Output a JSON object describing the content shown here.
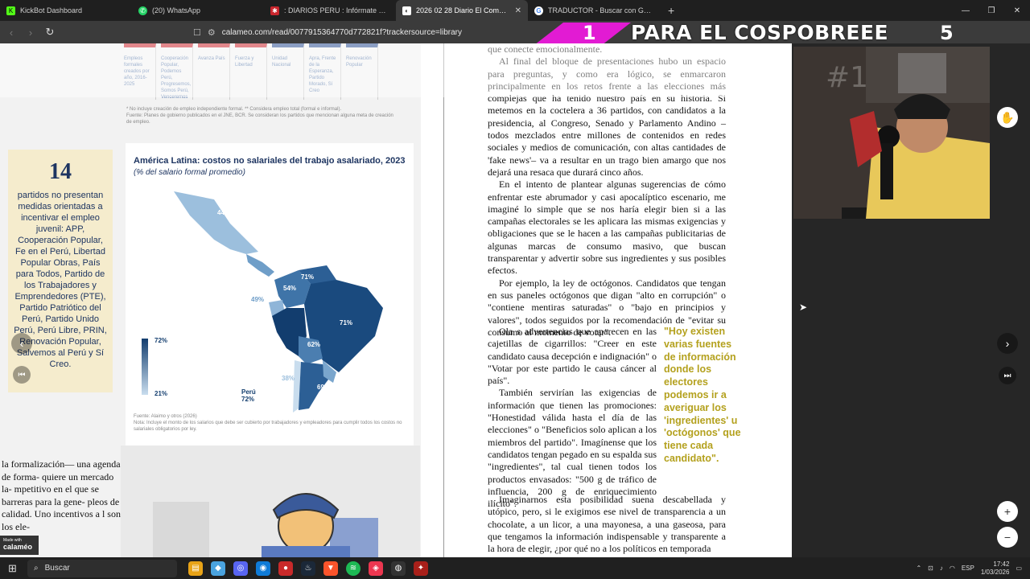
{
  "browser": {
    "tabs": [
      {
        "label": "KickBot Dashboard",
        "active": false,
        "icon": "kickbot-icon",
        "color": "#53fc18"
      },
      {
        "label": "(20) WhatsApp",
        "active": false,
        "icon": "whatsapp-icon",
        "color": "#25d366"
      },
      {
        "label": ": DIARIOS PERU : Infórmate GRatis :",
        "active": false,
        "icon": "diarios-icon",
        "color": "#c9262d"
      },
      {
        "label": "2026 02 28 Diario El Comercio",
        "active": true,
        "icon": "calameo-icon",
        "color": "#ffffff"
      },
      {
        "label": "TRADUCTOR - Buscar con Google",
        "active": false,
        "icon": "google-icon",
        "color": "#4285f4"
      }
    ],
    "new_tab": "+",
    "url": "calameo.com/read/0077915364770d772821f?trackersource=library"
  },
  "overlay_banner": {
    "left_number": "1",
    "title": "PARA EL COSPOBREEE",
    "right_number": "5"
  },
  "document": {
    "table_columns": [
      "Empleos formales creados por año, 2016-2025",
      "Cooperación Popular, Podemos Perú, Progresemos, Somos Perú, Venceremos",
      "Avanza País",
      "Fuerza y Libertad",
      "Unidad Nacional",
      "Apra, Frente de la Esperanza, Partido Morado, Sí Creo",
      "Renovación Popular"
    ],
    "note1": "* No incluye creación de empleo independiente formal. ** Considera empleo total (formal e informal).",
    "note2": "Fuente: Planes de gobierno publicados en el JNE, BCR. Se consideran los partidos que mencionan alguna meta de creación de empleo.",
    "panel_number": "14",
    "panel_text": "partidos no presentan medidas orientadas a incentivar el empleo juvenil: APP, Cooperación Popular, Fe en el Perú, Libertad Popular Obras, País para Todos, Partido de los Trabajadores y Emprendedores (PTE), Partido Patriótico del Perú, Partido Unido Perú, Perú Libre, PRIN, Renovación Popular, Salvemos al Perú y Sí Creo.",
    "map_title": "América Latina: costos no salariales del trabajo asalariado, 2023",
    "map_subtitle": "(% del salario formal promedio)",
    "map_labels": {
      "mexico": "44%",
      "venezuela": "71%",
      "colombia": "54%",
      "ecuador": "49%",
      "brazil": "71%",
      "bolivia": "62%",
      "chile": "38%",
      "argentina": "69%",
      "peru_name": "Perú",
      "peru_value": "72%",
      "legend_high": "72%",
      "legend_low": "21%"
    },
    "map_source": "Fuente: Alaimo y otros (2026)",
    "map_note": "Nota: Incluye el monto de los salarios que debe ser cubierto por trabajadores y empleadores para cumplir todos los costos no salariales obligatorios por ley.",
    "left_subhead": "la formalización— una agenda de forma- quiere un mercado la- mpetitivo en el que se barreras para la gene- pleos de calidad. Uno incentivos a l son los ele-",
    "right_col_top": [
      "que conecte emocionalmente.",
      "Al final del bloque de presentaciones hubo un espacio para preguntas, y como era lógico, se enmarcaron principalmente en los retos frente a las elecciones más complejas que ha tenido nuestro país en su historia. Si metemos en la coctelera a 36 partidos, con candidatos a la presidencia, al Congreso, Senado y Parlamento Andino –todos mezclados entre millones de contenidos en redes sociales y medios de comunicación, con altas cantidades de 'fake news'– va a resultar en un trago bien amargo que nos dejará una resaca que durará cinco años.",
      "En el intento de plantear algunas sugerencias de cómo enfrentar este abrumador y casi apocalíptico escenario, me imaginé lo simple que se nos haría elegir bien si a las campañas electorales se les aplicara las mismas exigencias y obligaciones que se le hacen a las campañas publicitarias de algunas marcas de consumo masivo, que buscan transparentar y advertir sobre sus ingredientes y sus posibles efectos.",
      "Por ejemplo, la ley de octógonos. Candidatos que tengan en sus paneles octógonos que digan \"alto en corrupción\" o \"contiene mentiras saturadas\" o \"bajo en principios y valores\", todos seguidos por la recomendación de \"evitar su consumo al momento de votar\"."
    ],
    "right_col_narrow": [
      "Ola s advertencias que aparecen en las cajetillas de cigarrillos: \"Creer en este candidato causa decepción e indignación\" o \"Votar por este partido le causa cáncer al país\".",
      "También servirían las exigencias de información que tienen las promociones: \"Honestidad válida hasta el día de las elecciones\" o \"Beneficios solo aplican a los miembros del partido\". Imagínense que los candidatos tengan pegado en su espalda sus \"ingredientes\", tal cual tienen todos los productos envasados: \"500 g de tráfico de influencia, 200 g de enriquecimiento ilícito\"."
    ],
    "pull_quote": "\"Hoy existen varias fuentes de información donde los electores podemos ir a averiguar los 'ingredientes' u 'octógonos' que tiene cada candidato\".",
    "right_col_bottom": "Imaginarnos esta posibilidad suena descabellada y utópico, pero, si le exigimos ese nivel de transparencia a un chocolate, a un licor, a una mayonesa, a una gaseosa, para que tengamos la información indispensable y transparente a la hora de elegir, ¿por qué no a los políticos en temporada",
    "viewer_badge_small": "Made with",
    "viewer_badge_brand": "calaméo"
  },
  "taskbar": {
    "search_placeholder": "Buscar",
    "language": "ESP",
    "time": "17:42",
    "date": "1/03/2026"
  },
  "colors": {
    "banner_pink": "#e21bd3",
    "map_dark": "#123d6e",
    "quote_gold": "#b4a11e",
    "panel_bg": "#f5eccd"
  }
}
